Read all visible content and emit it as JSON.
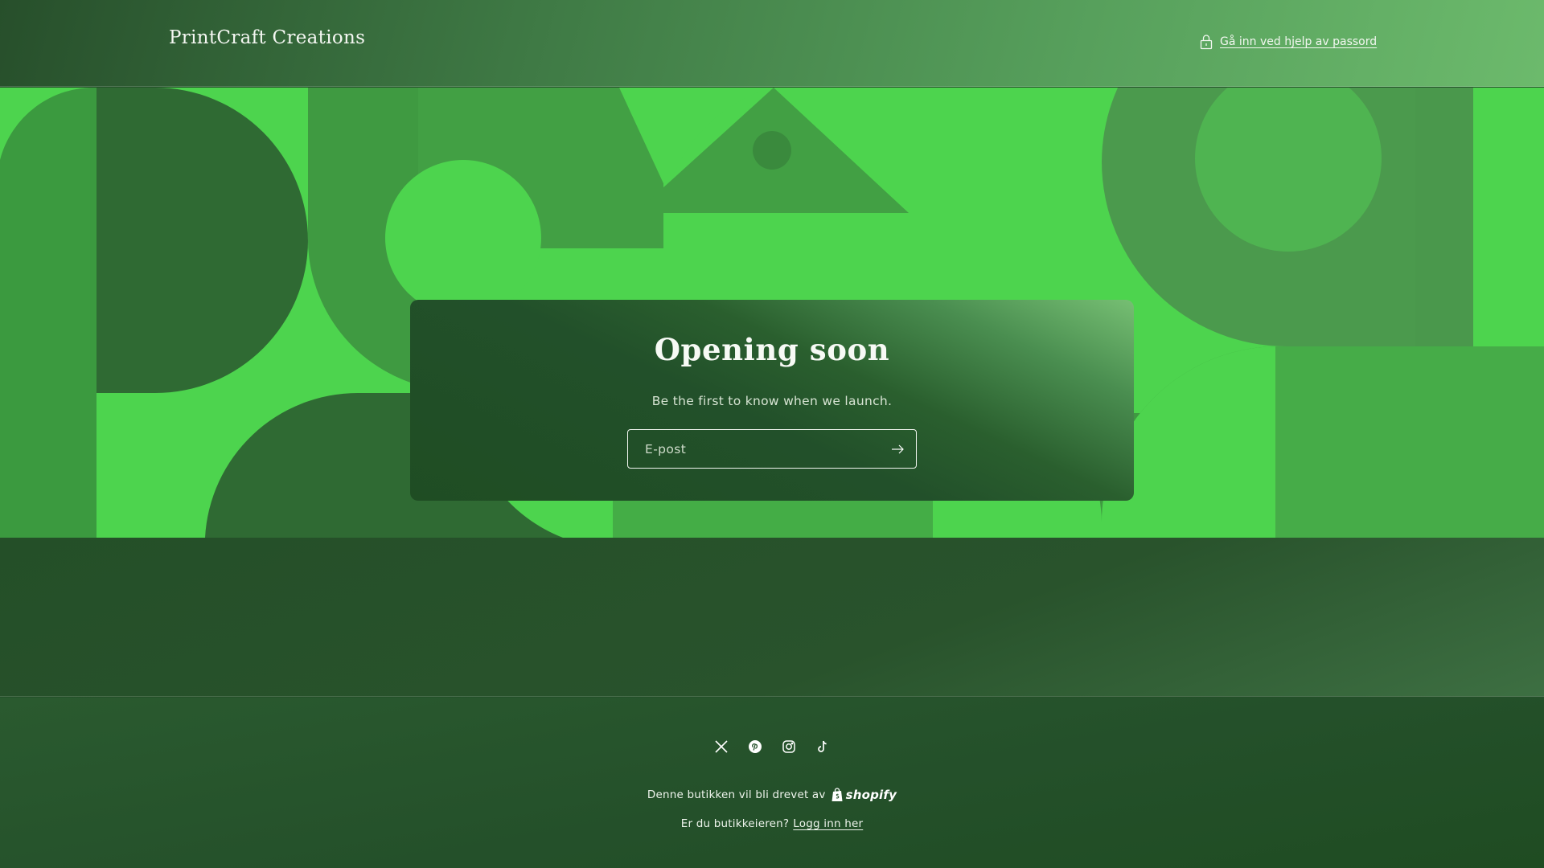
{
  "header": {
    "brand": "PrintCraft Creations",
    "password_link": "Gå inn ved hjelp av passord"
  },
  "hero": {
    "title": "Opening soon",
    "subtitle": "Be the first to know when we launch.",
    "email_placeholder": "E-post"
  },
  "footer": {
    "socials": [
      "x-icon",
      "pinterest-icon",
      "instagram-icon",
      "tiktok-icon"
    ],
    "powered_by": "Denne butikken vil bli drevet av",
    "shopify": "shopify",
    "owner_question": "Er du butikkeieren?",
    "login_link": "Logg inn her"
  },
  "colors": {
    "bright_green": "#4dd44e",
    "dark_green": "#24502a"
  }
}
